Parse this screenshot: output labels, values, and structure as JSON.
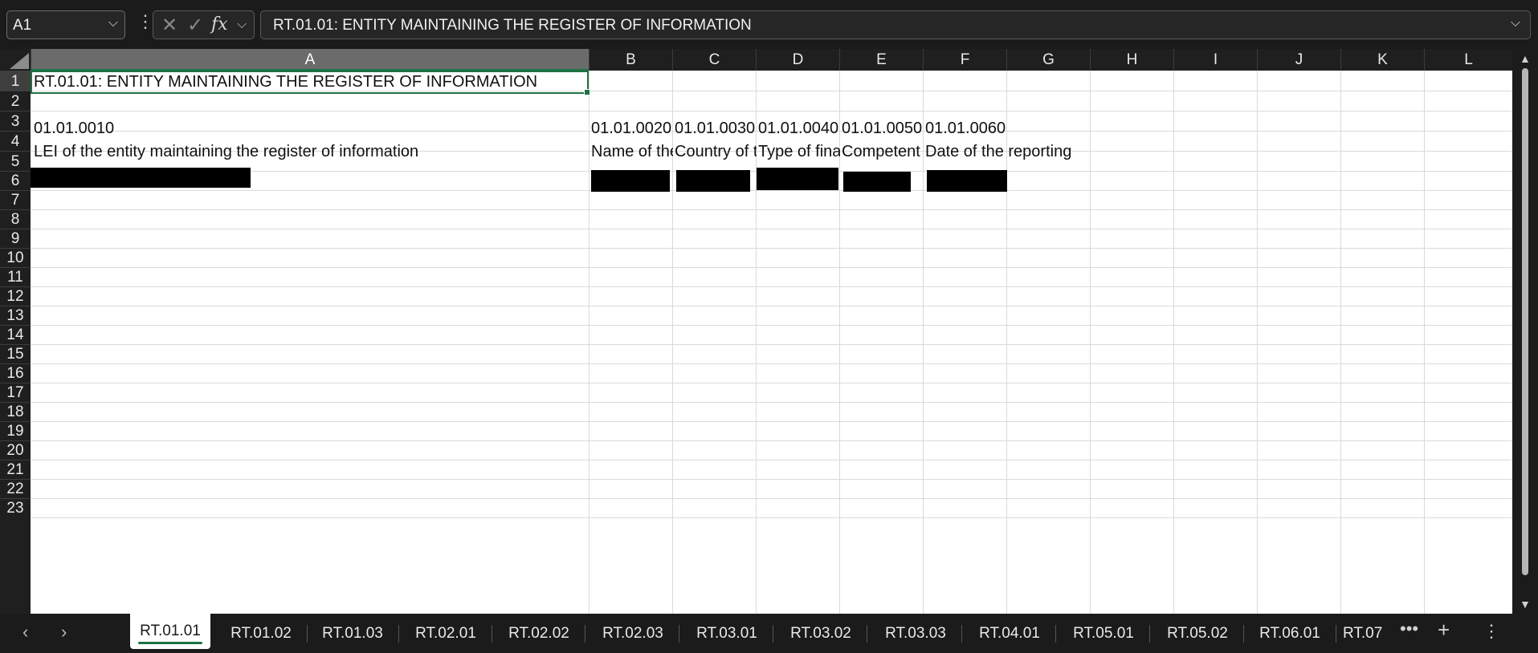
{
  "formula_bar": {
    "name_box": "A1",
    "formula": "RT.01.01: ENTITY MAINTAINING THE REGISTER OF INFORMATION",
    "cancel_icon": "x-icon",
    "enter_icon": "check-icon",
    "function_label": "fx"
  },
  "columns": [
    "A",
    "B",
    "C",
    "D",
    "E",
    "F",
    "G",
    "H",
    "I",
    "J",
    "K",
    "L"
  ],
  "rows": [
    "1",
    "2",
    "3",
    "4",
    "5",
    "6",
    "7",
    "8",
    "9",
    "10",
    "11",
    "12",
    "13",
    "14",
    "15",
    "16",
    "17",
    "18",
    "19",
    "20",
    "21",
    "22",
    "23"
  ],
  "cells": {
    "A1": "RT.01.01: ENTITY MAINTAINING THE REGISTER OF INFORMATION",
    "A3": "01.01.0010",
    "B3": "01.01.0020",
    "C3": "01.01.0030",
    "D3": "01.01.0040",
    "E3": "01.01.0050",
    "F3": "01.01.0060",
    "A4": "LEI of the entity maintaining the register of information",
    "B4": "Name of the entity",
    "C4": "Country of the entity",
    "D4": "Type of financial entity",
    "E4": "Competent Authority",
    "F4": "Date of the reporting"
  },
  "sheet_tabs": [
    "RT.01.01",
    "RT.01.02",
    "RT.01.03",
    "RT.02.01",
    "RT.02.02",
    "RT.02.03",
    "RT.03.01",
    "RT.03.02",
    "RT.03.03",
    "RT.04.01",
    "RT.05.01",
    "RT.05.02",
    "RT.06.01",
    "RT.07"
  ],
  "active_tab": "RT.01.01",
  "icons": {
    "prev": "chevron-left-icon",
    "next": "chevron-right-icon",
    "more": "more-icon",
    "add": "plus-icon",
    "menu": "kebab-icon"
  },
  "colors": {
    "accent": "#1e7145",
    "chrome": "#1b1b1b"
  }
}
